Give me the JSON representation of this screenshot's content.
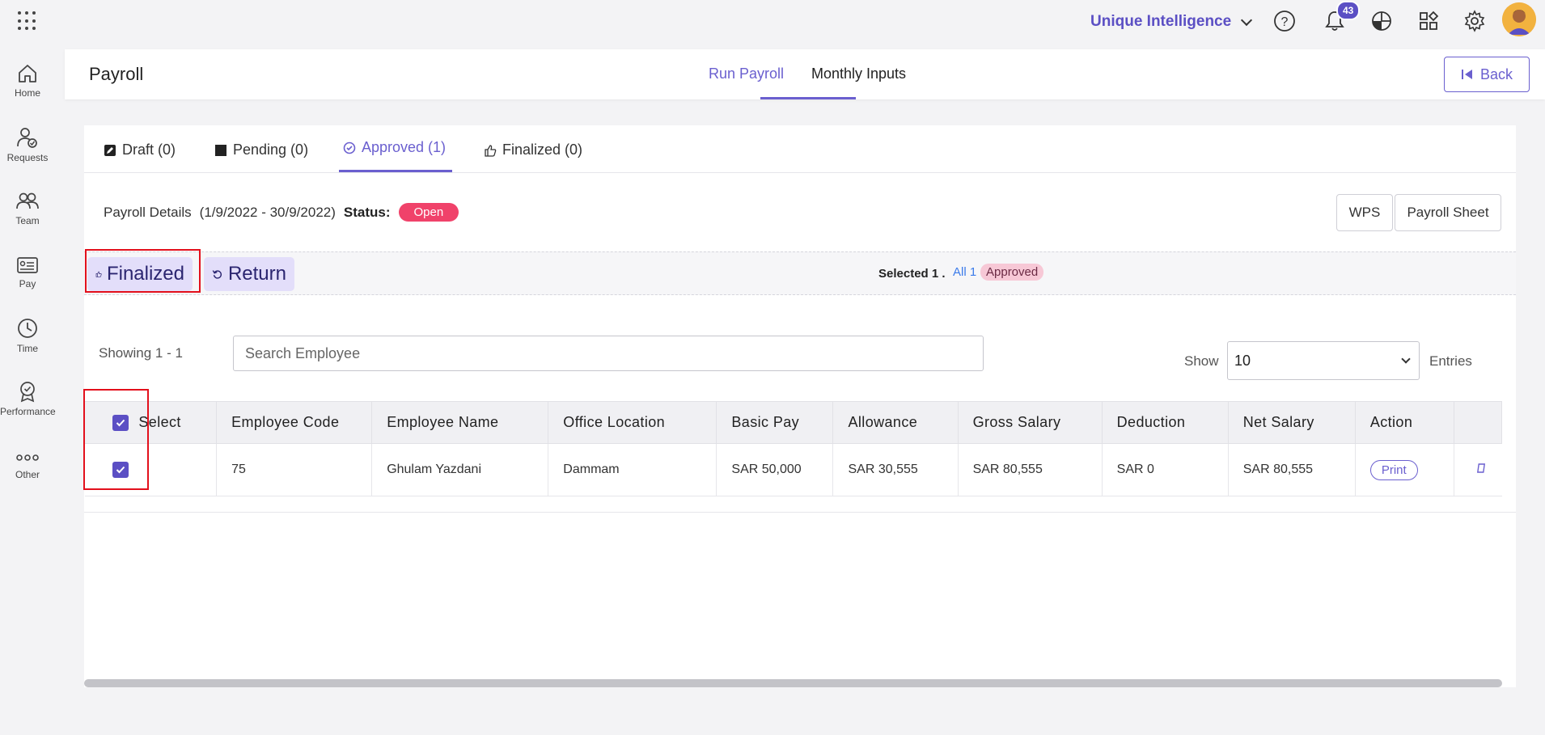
{
  "topbar": {
    "company_name": "Unique Intelligence",
    "notification_count": "43",
    "accent_color": "#5b4fc4"
  },
  "sidebar": {
    "items": [
      {
        "label": "Home",
        "icon": "home-icon"
      },
      {
        "label": "Requests",
        "icon": "requests-icon"
      },
      {
        "label": "Team",
        "icon": "team-icon"
      },
      {
        "label": "Pay",
        "icon": "pay-icon"
      },
      {
        "label": "Time",
        "icon": "clock-icon"
      },
      {
        "label": "Performance",
        "icon": "award-icon"
      },
      {
        "label": "Other",
        "icon": "more-icon"
      }
    ]
  },
  "header": {
    "title": "Payroll",
    "tabs": [
      {
        "label": "Run Payroll",
        "active": true
      },
      {
        "label": "Monthly Inputs",
        "active": false
      }
    ],
    "back_label": "Back"
  },
  "status_tabs": [
    {
      "label": "Draft (0)",
      "icon": "edit-icon",
      "active": false
    },
    {
      "label": "Pending (0)",
      "icon": "square-icon",
      "active": false
    },
    {
      "label": "Approved (1)",
      "icon": "check-circle-icon",
      "active": true
    },
    {
      "label": "Finalized (0)",
      "icon": "thumbs-up-icon",
      "active": false
    }
  ],
  "details": {
    "label": "Payroll Details",
    "period": "(1/9/2022 - 30/9/2022)",
    "status_label": "Status:",
    "status_value": "Open",
    "status_color": "#f0426a"
  },
  "buttons": {
    "wps": "WPS",
    "payroll_sheet": "Payroll Sheet"
  },
  "actions": {
    "finalized_label": "Finalized",
    "return_label": "Return",
    "selected_text": "Selected 1 .",
    "all_link": "All 1",
    "approved_badge": "Approved"
  },
  "search": {
    "showing": "Showing 1 - 1",
    "placeholder": "Search Employee",
    "show_label": "Show",
    "entries_value": "10",
    "entries_label": "Entries"
  },
  "table": {
    "headers": [
      "Select",
      "Employee Code",
      "Employee Name",
      "Office Location",
      "Basic Pay",
      "Allowance",
      "Gross Salary",
      "Deduction",
      "Net Salary",
      "Action"
    ],
    "rows": [
      {
        "selected": true,
        "code": "75",
        "name": "Ghulam Yazdani",
        "location": "Dammam",
        "basic_pay": "SAR 50,000",
        "allowance": "SAR 30,555",
        "gross": "SAR 80,555",
        "deduction": "SAR 0",
        "net": "SAR 80,555",
        "action_label": "Print"
      }
    ]
  }
}
